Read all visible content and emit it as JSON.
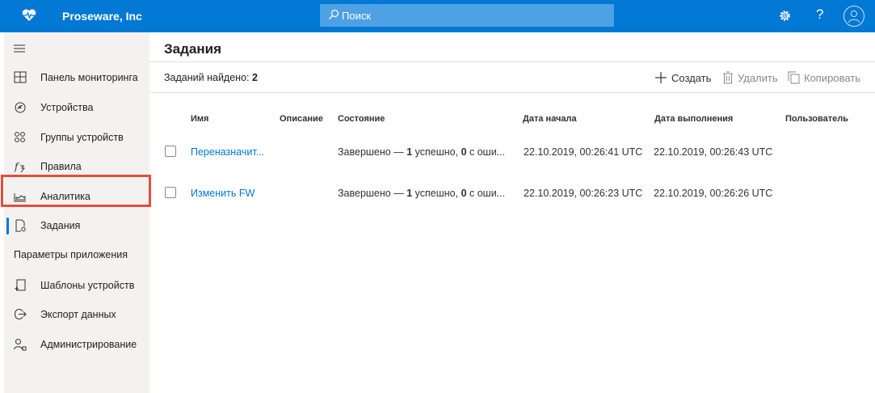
{
  "header": {
    "brand": "Proseware, Inc",
    "search_placeholder": "Поиск",
    "help_label": "?",
    "colors": {
      "topbar": "#0078d4",
      "search": "#4da1e4",
      "accent": "#0078d4",
      "highlight": "#e74c3c"
    }
  },
  "sidebar": {
    "items": [
      {
        "label": "Панель мониторинга",
        "icon": "dashboard-icon"
      },
      {
        "label": "Устройства",
        "icon": "devices-icon"
      },
      {
        "label": "Группы устройств",
        "icon": "device-groups-icon"
      },
      {
        "label": "Правила",
        "icon": "rules-icon"
      },
      {
        "label": "Аналитика",
        "icon": "analytics-icon"
      },
      {
        "label": "Задания",
        "icon": "jobs-icon",
        "active": true
      }
    ],
    "section_title": "Параметры приложения",
    "settings_items": [
      {
        "label": "Шаблоны устройств",
        "icon": "device-templates-icon"
      },
      {
        "label": "Экспорт данных",
        "icon": "data-export-icon"
      },
      {
        "label": "Администрирование",
        "icon": "administration-icon"
      }
    ]
  },
  "main": {
    "title": "Задания",
    "found_label": "Заданий найдено:",
    "found_count": "2",
    "commands": {
      "create": "Создать",
      "delete": "Удалить",
      "copy": "Копировать"
    },
    "table": {
      "headers": [
        "Имя",
        "Описание",
        "Состояние",
        "Дата начала",
        "Дата выполнения",
        "Пользователь"
      ],
      "rows": [
        {
          "name": "Переназначит...",
          "description": "",
          "status_prefix": "Завершено —",
          "status_success_count": "1",
          "status_mid": "успешно,",
          "status_error_count": "0",
          "status_suffix": "с оши...",
          "start": "22.10.2019, 00:26:41 UTC",
          "end": "22.10.2019, 00:26:43 UTC",
          "user": ""
        },
        {
          "name": "Изменить FW",
          "description": "",
          "status_prefix": "Завершено —",
          "status_success_count": "1",
          "status_mid": "успешно,",
          "status_error_count": "0",
          "status_suffix": "с оши...",
          "start": "22.10.2019, 00:26:23 UTC",
          "end": "22.10.2019, 00:26:26 UTC",
          "user": ""
        }
      ]
    }
  }
}
